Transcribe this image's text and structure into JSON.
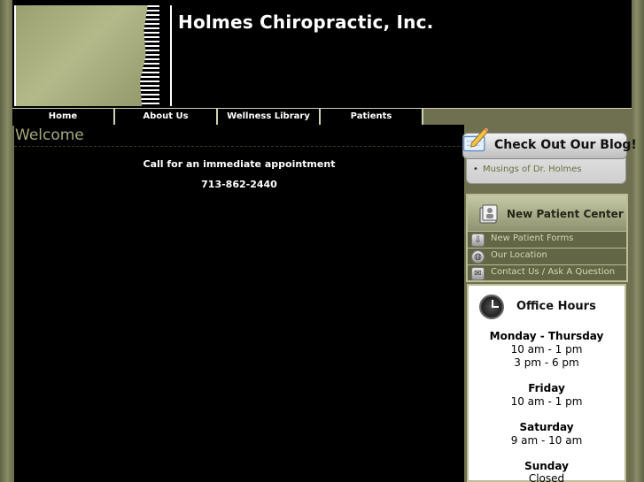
{
  "site": {
    "title": "Holmes Chiropractic, Inc."
  },
  "nav": {
    "items": [
      {
        "label": "Home"
      },
      {
        "label": "About Us"
      },
      {
        "label": "Wellness Library"
      },
      {
        "label": "Patients"
      }
    ]
  },
  "main": {
    "heading": "Welcome",
    "call_text": "Call for an immediate appointment",
    "phone": "713-862-2440"
  },
  "blog": {
    "title": "Check Out Our Blog!",
    "bullet": "•",
    "link": "Musings of Dr. Holmes"
  },
  "new_patient_center": {
    "title": "New Patient Center",
    "items": [
      {
        "label": "New Patient Forms",
        "icon": "download-icon"
      },
      {
        "label": "Our Location",
        "icon": "globe-icon"
      },
      {
        "label": "Contact Us / Ask A Question",
        "icon": "envelope-icon"
      }
    ]
  },
  "office_hours": {
    "title": "Office Hours",
    "days": [
      {
        "day": "Monday - Thursday",
        "times": [
          "10 am - 1 pm",
          "3 pm - 6 pm"
        ]
      },
      {
        "day": "Friday",
        "times": [
          "10 am - 1 pm"
        ]
      },
      {
        "day": "Saturday",
        "times": [
          "9 am - 10 am"
        ]
      },
      {
        "day": "Sunday",
        "times": [
          "Closed"
        ]
      }
    ]
  },
  "colors": {
    "frame": "#6e7050",
    "accent_text": "#a6aa7c",
    "link": "#6b6f3f"
  }
}
